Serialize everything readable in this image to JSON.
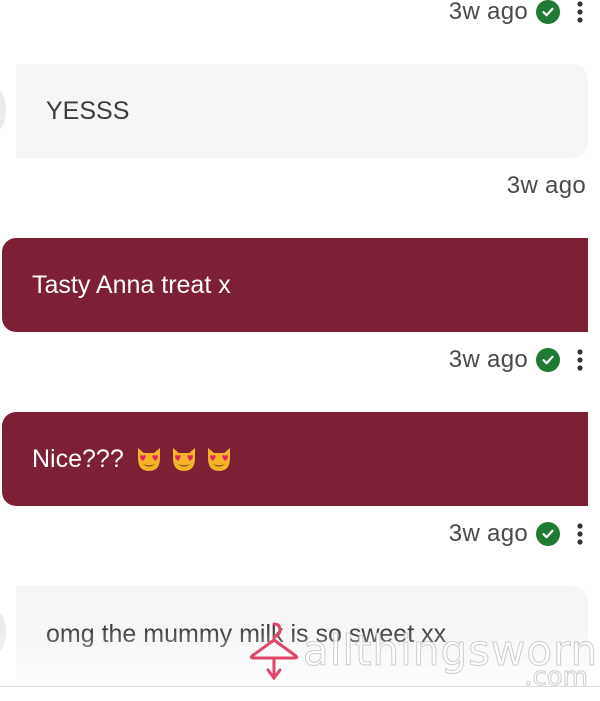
{
  "colors": {
    "outgoing_bubble": "#7e2035",
    "incoming_bubble": "#f5f6f8",
    "read_check": "#1f7a32",
    "watermark_pink": "#e0456a"
  },
  "messages": [
    {
      "type": "meta",
      "time": "3w ago",
      "read": true
    },
    {
      "type": "incoming",
      "text": "YESSS"
    },
    {
      "type": "meta",
      "time": "3w ago",
      "read": false
    },
    {
      "type": "outgoing",
      "text": "Tasty Anna treat x"
    },
    {
      "type": "meta",
      "time": "3w ago",
      "read": true
    },
    {
      "type": "outgoing",
      "text": "Nice???",
      "emoji": [
        "heart-eyes-cat-emoji",
        "heart-eyes-cat-emoji",
        "heart-eyes-cat-emoji"
      ]
    },
    {
      "type": "meta",
      "time": "3w ago",
      "read": true
    },
    {
      "type": "incoming",
      "text": "omg the mummy milk is so sweet xx"
    }
  ],
  "watermark": {
    "brand": "allthingsworn",
    "domain": ".com"
  }
}
